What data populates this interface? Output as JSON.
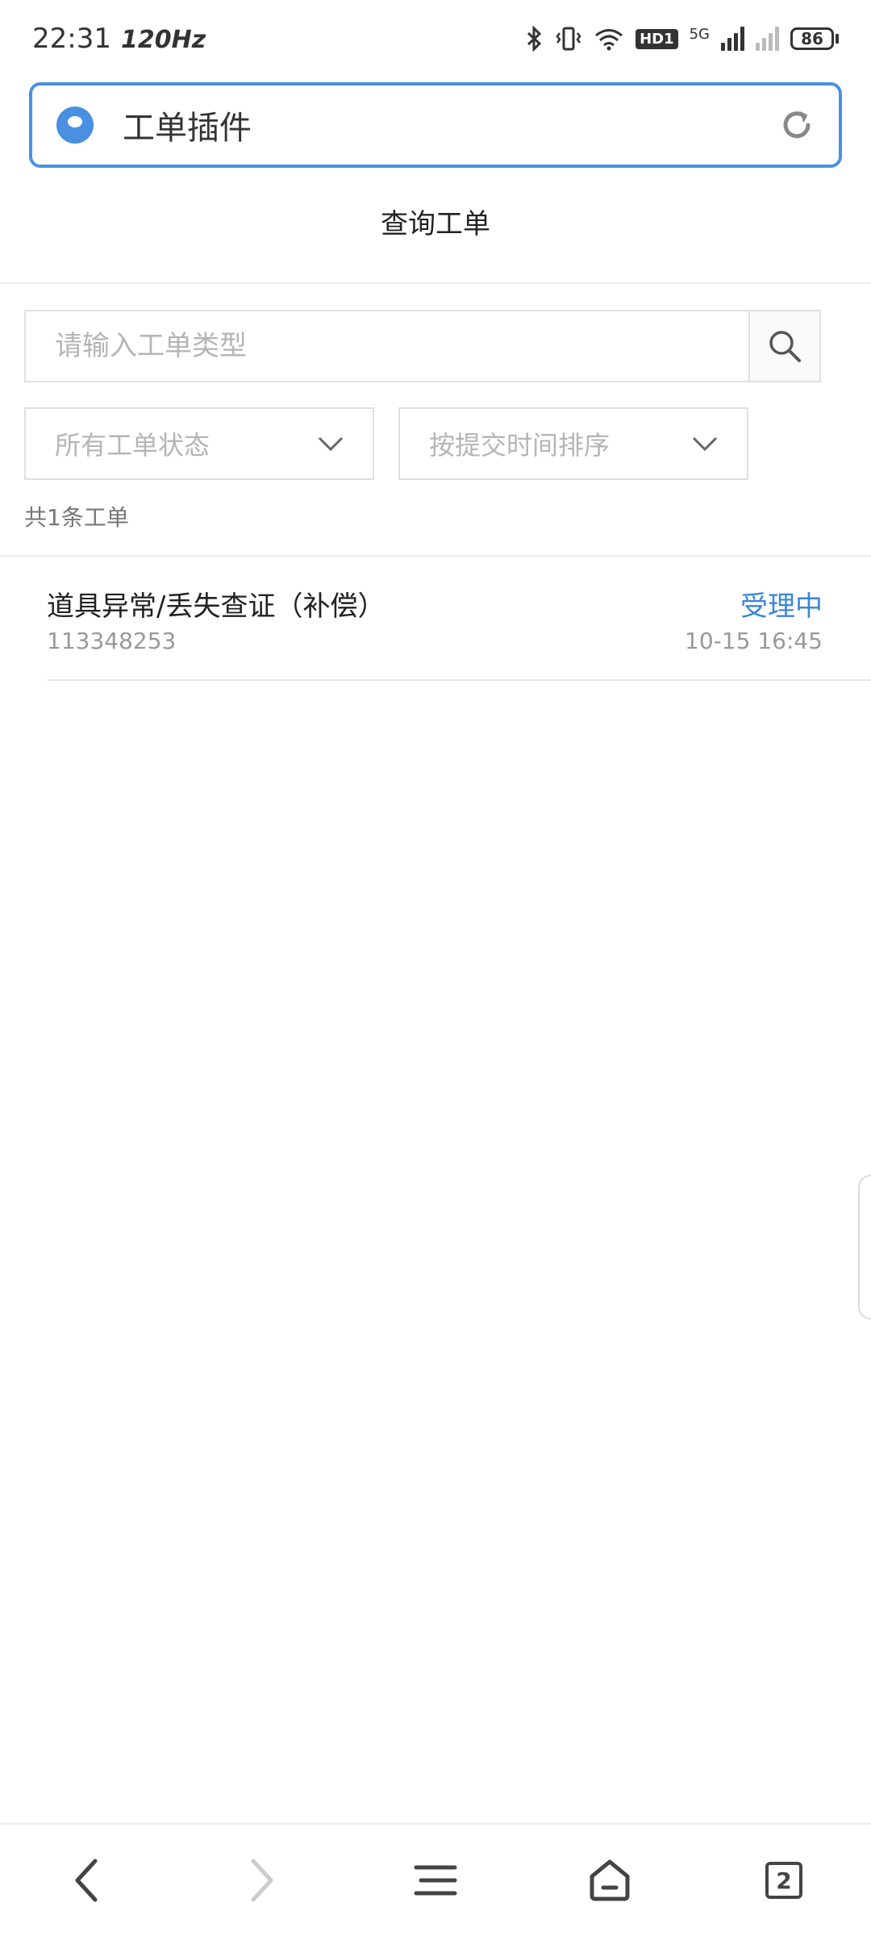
{
  "status_bar": {
    "time": "22:31",
    "refresh_rate": "120Hz",
    "hd_badge": "HD1",
    "network": "5G",
    "battery": "86"
  },
  "browser": {
    "page_title": "工单插件"
  },
  "header": {
    "title": "查询工单"
  },
  "search": {
    "placeholder": "请输入工单类型"
  },
  "filters": {
    "status_select": "所有工单状态",
    "sort_select": "按提交时间排序"
  },
  "list": {
    "count_text": "共1条工单",
    "tickets": [
      {
        "title": "道具异常/丢失查证（补偿）",
        "id": "113348253",
        "status": "受理中",
        "time": "10-15 16:45"
      }
    ]
  },
  "bottom_nav": {
    "tabs_count": "2"
  },
  "colors": {
    "accent": "#4a90e2",
    "status_blue": "#3b86d6"
  }
}
